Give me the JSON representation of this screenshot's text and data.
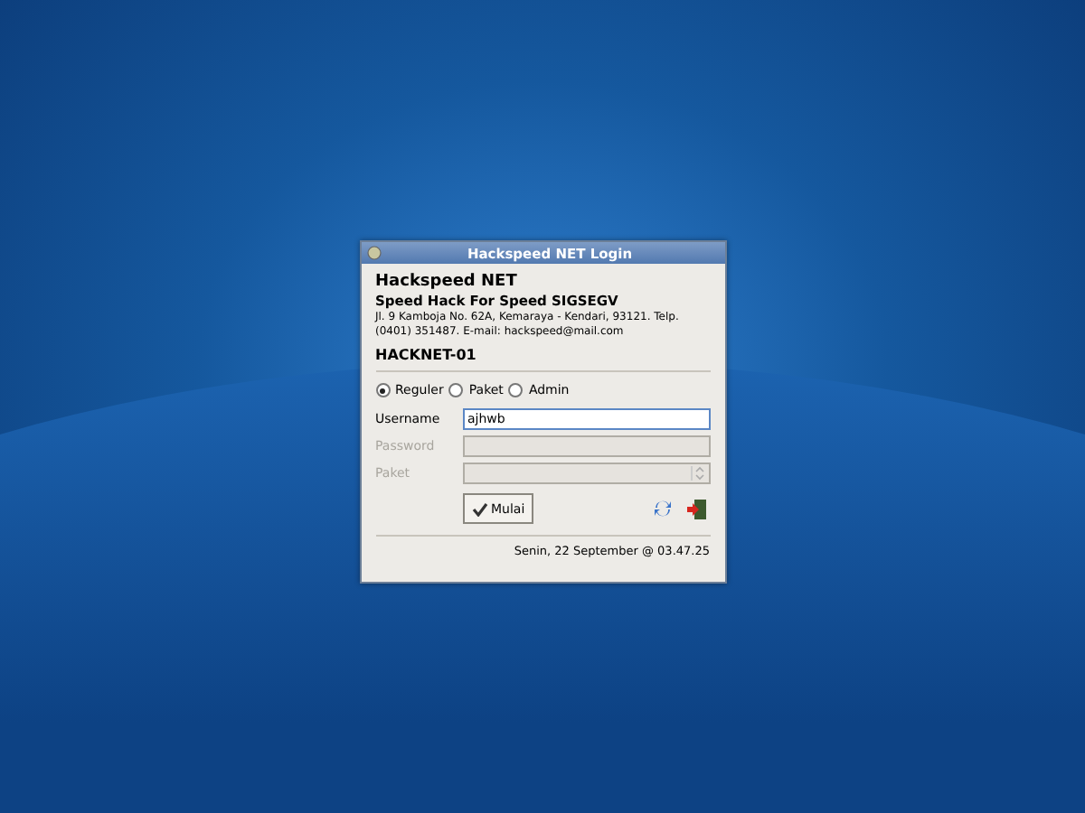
{
  "window": {
    "title": "Hackspeed NET Login"
  },
  "header": {
    "name": "Hackspeed NET",
    "tagline": "Speed Hack For Speed SIGSEGV",
    "address": "Jl. 9 Kamboja No. 62A, Kemaraya - Kendari, 93121. Telp. (0401) 351487. E-mail:  hackspeed@mail.com"
  },
  "station": "HACKNET-01",
  "modes": [
    {
      "label": "Reguler",
      "selected": true
    },
    {
      "label": "Paket",
      "selected": false
    },
    {
      "label": "Admin",
      "selected": false
    }
  ],
  "fields": [
    {
      "label": "Username",
      "kind": "text",
      "value": "ajhwb",
      "disabled": false,
      "focused": true
    },
    {
      "label": "Password",
      "kind": "text",
      "disabled": true,
      "focused": false
    },
    {
      "label": "Paket",
      "kind": "select",
      "disabled": true,
      "focused": false
    }
  ],
  "start_button": "Mulai",
  "status": "Senin, 22 September @ 03.47.25"
}
